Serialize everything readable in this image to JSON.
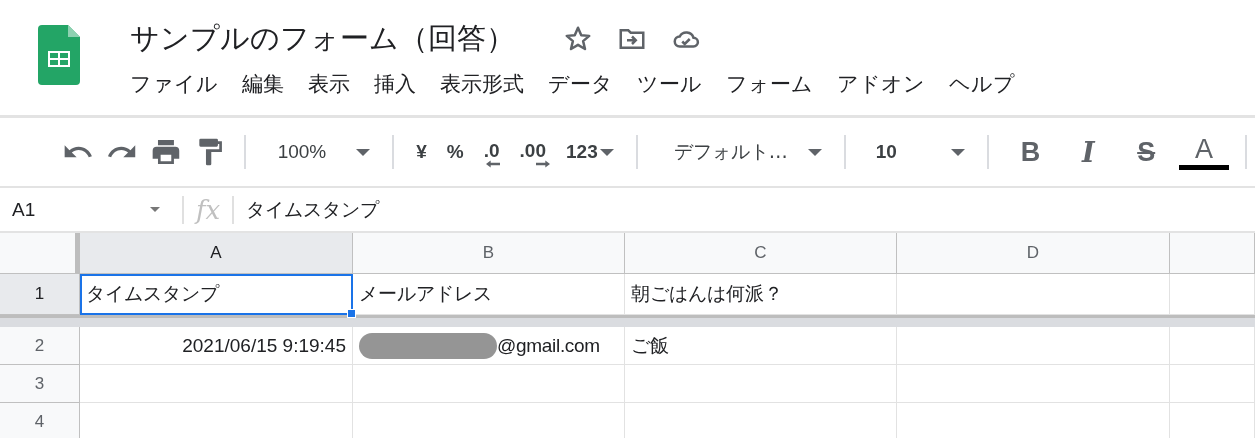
{
  "document": {
    "title": "サンプルのフォーム（回答）"
  },
  "menu": [
    "ファイル",
    "編集",
    "表示",
    "挿入",
    "表示形式",
    "データ",
    "ツール",
    "フォーム",
    "アドオン",
    "ヘルプ"
  ],
  "toolbar": {
    "zoom": "100%",
    "currency": "¥",
    "percent": "%",
    "decrease_decimal": ".0",
    "increase_decimal": ".00",
    "number_format": "123",
    "font": "デフォルト…",
    "font_size": "10",
    "bold": "B",
    "italic": "I",
    "strikethrough": "S",
    "text_color": "A"
  },
  "formula_bar": {
    "cell_ref": "A1",
    "fx": "fx",
    "value": "タイムスタンプ"
  },
  "columns": [
    {
      "label": "A",
      "selected": true
    },
    {
      "label": "B",
      "selected": false
    },
    {
      "label": "C",
      "selected": false
    },
    {
      "label": "D",
      "selected": false
    }
  ],
  "rows": [
    {
      "label": "1",
      "selected": true,
      "cells": [
        {
          "kind": "text",
          "text": "タイムスタンプ",
          "selected": true
        },
        {
          "kind": "text",
          "text": "メールアドレス",
          "selected": false
        },
        {
          "kind": "text",
          "text": "朝ごはんは何派？",
          "selected": false
        }
      ]
    },
    {
      "label": "2",
      "selected": false,
      "cells": [
        {
          "kind": "number",
          "text": "2021/06/15 9:19:45",
          "selected": false
        },
        {
          "kind": "redacted",
          "text": "@gmail.com",
          "selected": false
        },
        {
          "kind": "text",
          "text": "ご飯",
          "selected": false
        }
      ]
    },
    {
      "label": "3",
      "selected": false
    },
    {
      "label": "4",
      "selected": false
    }
  ]
}
